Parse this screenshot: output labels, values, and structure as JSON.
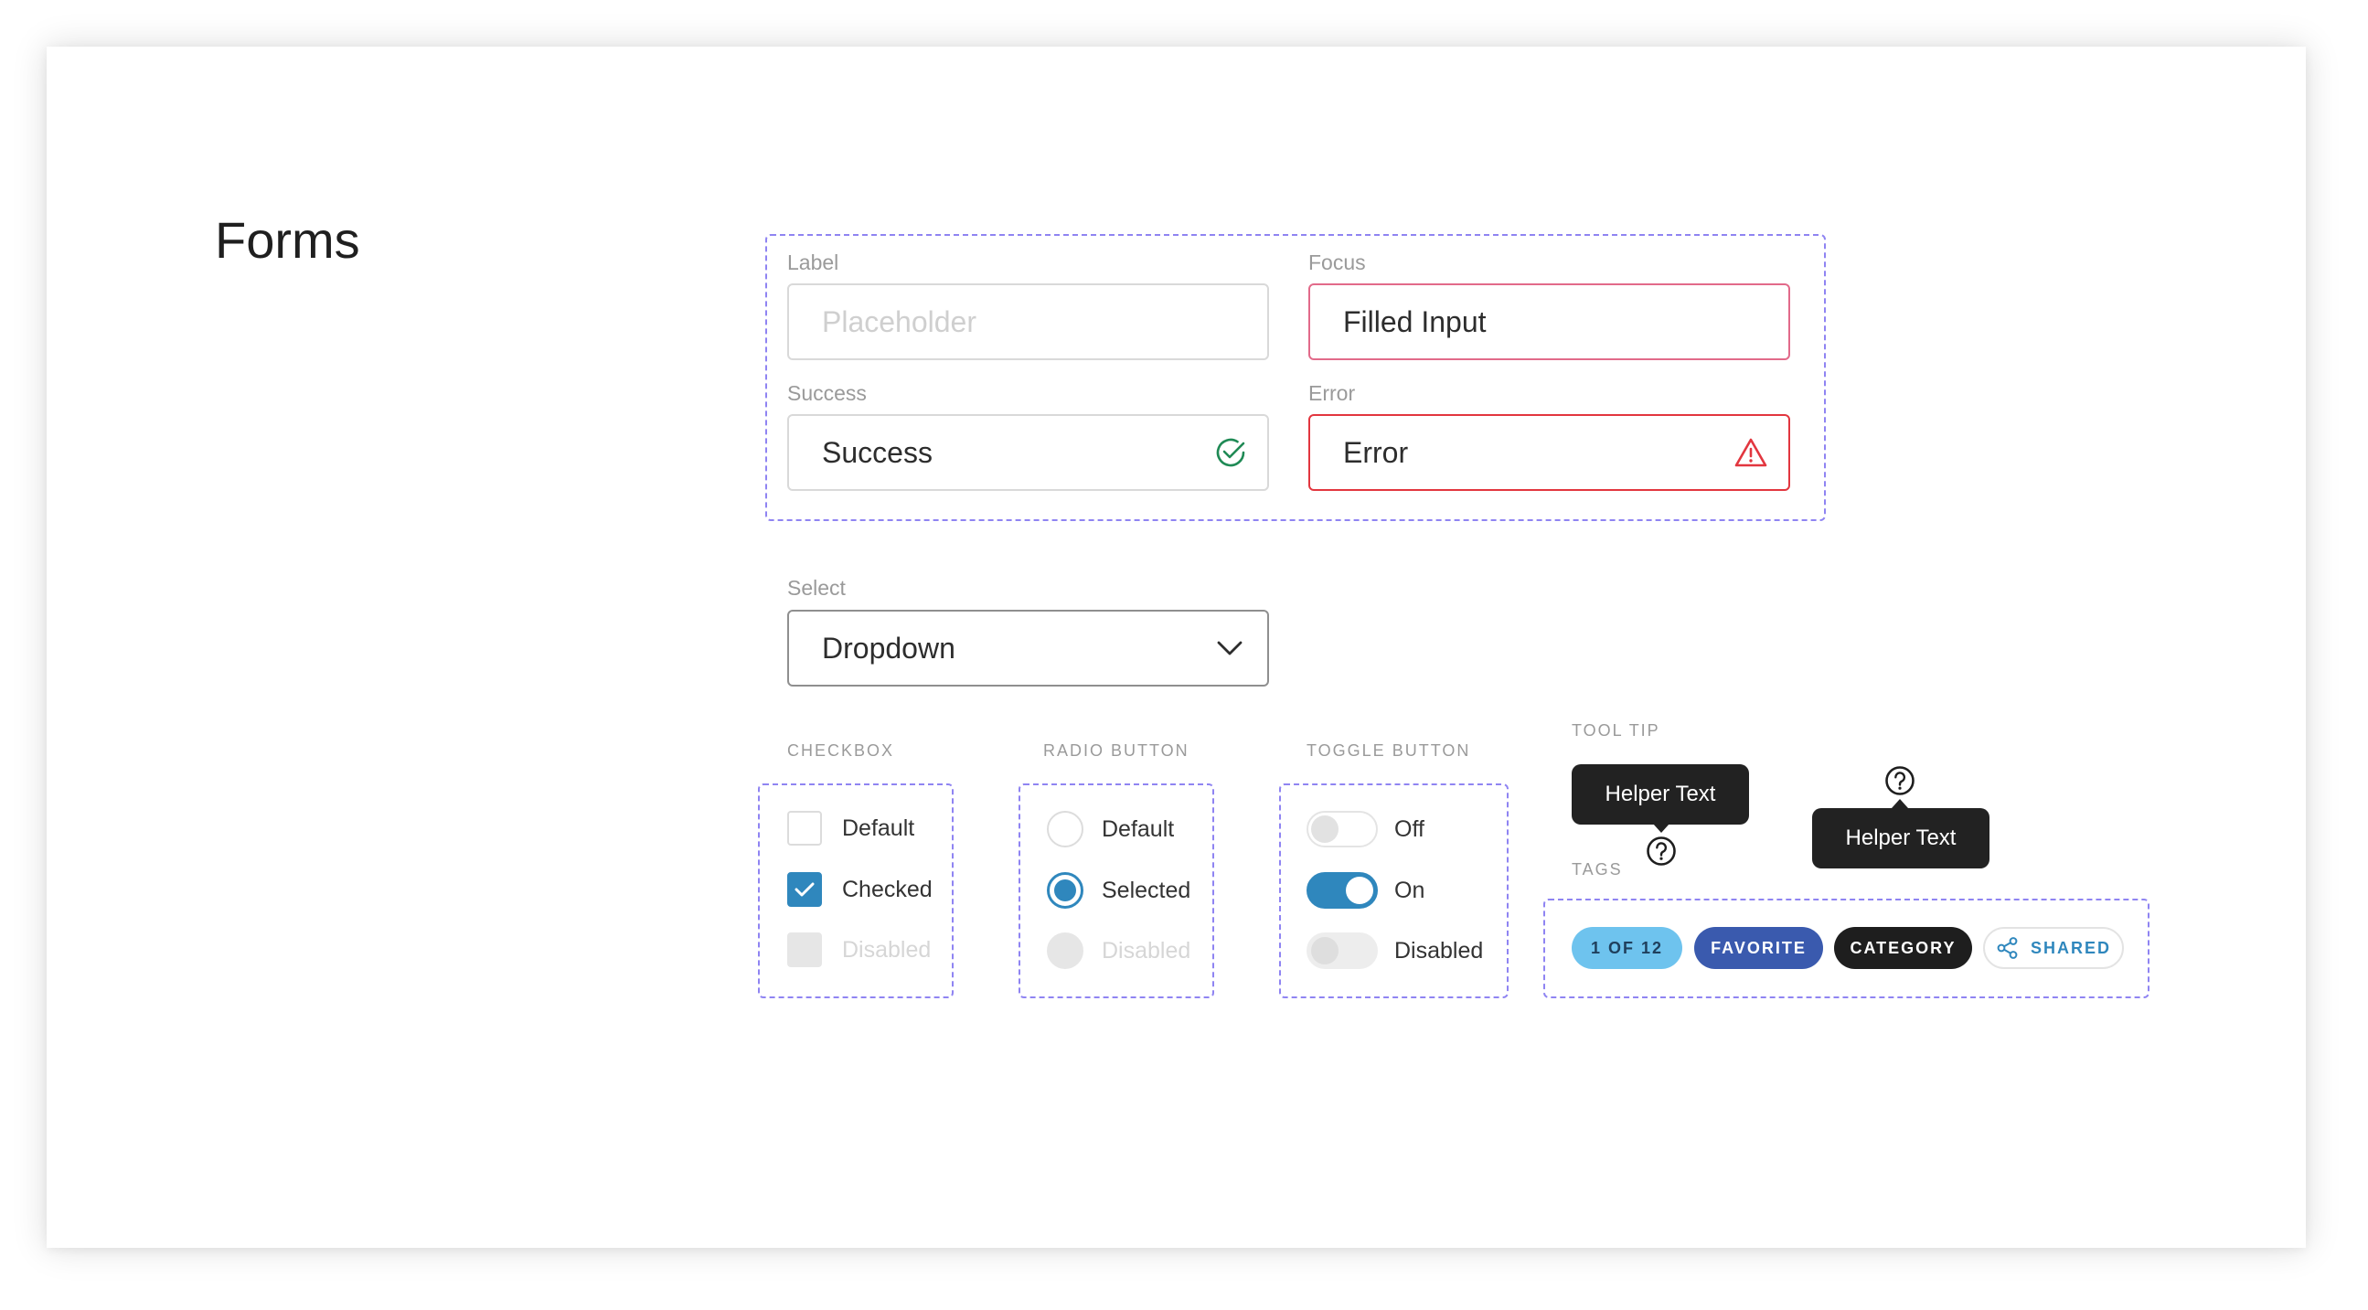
{
  "page": {
    "title": "Forms"
  },
  "inputs": {
    "label": {
      "label": "Label",
      "placeholder": "Placeholder"
    },
    "focus": {
      "label": "Focus",
      "value": "Filled Input"
    },
    "success": {
      "label": "Success",
      "value": "Success"
    },
    "error": {
      "label": "Error",
      "value": "Error"
    }
  },
  "select": {
    "label": "Select",
    "value": "Dropdown"
  },
  "checkbox": {
    "heading": "CHECKBOX",
    "items": [
      {
        "label": "Default",
        "state": "default"
      },
      {
        "label": "Checked",
        "state": "checked"
      },
      {
        "label": "Disabled",
        "state": "disabled"
      }
    ]
  },
  "radio": {
    "heading": "RADIO BUTTON",
    "items": [
      {
        "label": "Default",
        "state": "default"
      },
      {
        "label": "Selected",
        "state": "selected"
      },
      {
        "label": "Disabled",
        "state": "disabled"
      }
    ]
  },
  "toggle": {
    "heading": "TOGGLE BUTTON",
    "items": [
      {
        "label": "Off",
        "state": "off"
      },
      {
        "label": "On",
        "state": "on"
      },
      {
        "label": "Disabled",
        "state": "disabled"
      }
    ]
  },
  "tooltip": {
    "heading": "TOOL TIP",
    "items": [
      {
        "text": "Helper Text",
        "icon": "help-icon",
        "placement": "top"
      },
      {
        "text": "Helper Text",
        "icon": "help-icon",
        "placement": "bottom"
      }
    ]
  },
  "tags": {
    "heading": "TAGS",
    "items": [
      {
        "label": "1 OF 12",
        "bg": "#6ec3ee",
        "color": "#1f3f5c"
      },
      {
        "label": "FAVORITE",
        "bg": "#3a5aae",
        "color": "#ffffff"
      },
      {
        "label": "CATEGORY",
        "bg": "#1e1e1e",
        "color": "#ffffff"
      },
      {
        "label": "SHARED",
        "bg": "#ffffff",
        "color": "#2f87bd",
        "icon": "share-icon"
      }
    ]
  },
  "colors": {
    "accent": "#2f87bd",
    "success": "#1f8a55",
    "error": "#e2363f",
    "focus": "#e26a8a",
    "dashed_outline": "#8f84f2"
  }
}
